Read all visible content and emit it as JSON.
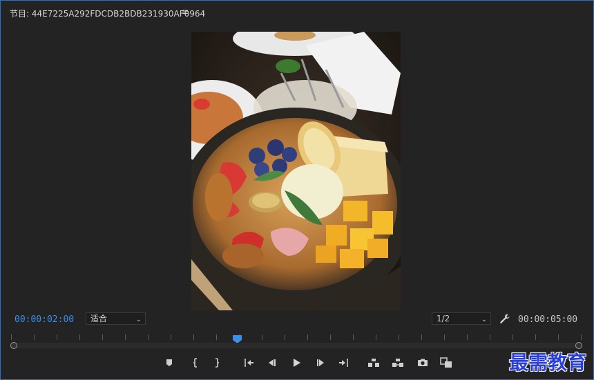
{
  "panel": {
    "title": "节目: 44E7225A292FDCDB2BDB231930AF0964",
    "menu_icon": "hamburger-menu-icon",
    "border_color": "#2f6fc7"
  },
  "monitor": {
    "current_timecode": "00:00:02:00",
    "duration_timecode": "00:00:05:00",
    "fit_label": "适合",
    "resolution_label": "1/2",
    "playhead_position": 0.4,
    "current_timecode_color": "#3b8fe8"
  },
  "transport": {
    "buttons": [
      {
        "name": "add-marker-icon"
      },
      {
        "name": "mark-in-icon"
      },
      {
        "name": "mark-out-icon"
      },
      {
        "name": "go-to-in-icon"
      },
      {
        "name": "step-back-icon"
      },
      {
        "name": "play-icon"
      },
      {
        "name": "step-forward-icon"
      },
      {
        "name": "go-to-out-icon"
      },
      {
        "name": "lift-icon"
      },
      {
        "name": "extract-icon"
      },
      {
        "name": "export-frame-icon"
      },
      {
        "name": "comparison-view-icon"
      }
    ]
  },
  "watermark": {
    "text": "最需教育",
    "color": "#2a3fd8"
  }
}
